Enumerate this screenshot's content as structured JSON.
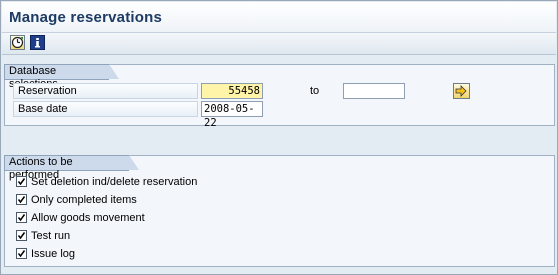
{
  "window": {
    "title": "Manage reservations"
  },
  "toolbar": {
    "execute_icon": "execute-clock-icon",
    "info_icon": "info-icon"
  },
  "db_selections": {
    "title": "Database selections",
    "reservation_label": "Reservation",
    "reservation_value": "55458",
    "to_label": "to",
    "reservation_to_value": "",
    "base_date_label": "Base date",
    "base_date_value": "2008-05-22",
    "multiple_selection_icon": "arrow-right-icon"
  },
  "actions": {
    "title": "Actions to be performed",
    "items": [
      {
        "label": "Set deletion ind/delete reservation",
        "checked": true
      },
      {
        "label": "Only completed items",
        "checked": true
      },
      {
        "label": "Allow goods movement",
        "checked": true
      },
      {
        "label": "Test run",
        "checked": true
      },
      {
        "label": "Issue log",
        "checked": true
      }
    ]
  },
  "colors": {
    "title": "#1d3b63",
    "required_field": "#fff4a8",
    "group_header": "#cddaeb"
  }
}
